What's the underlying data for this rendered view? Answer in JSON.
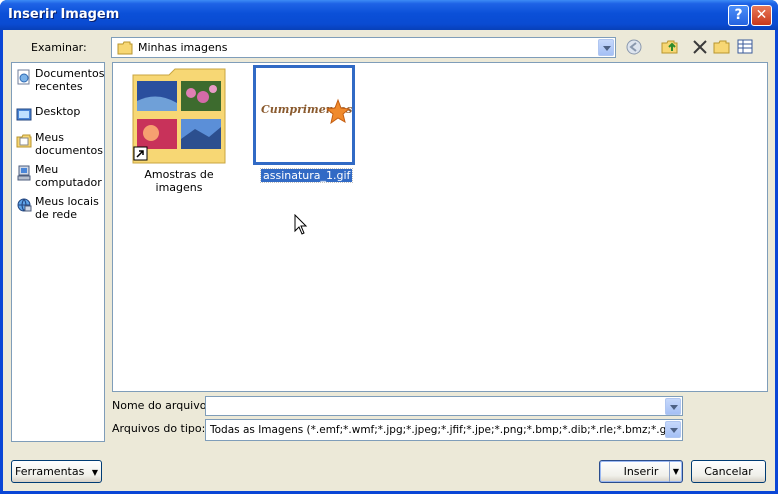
{
  "window": {
    "title": "Inserir Imagem"
  },
  "toolbar": {
    "look_in_label": "Examinar:",
    "look_in_value": "Minhas imagens"
  },
  "places": [
    {
      "label_line1": "Documentos",
      "label_line2": "recentes",
      "icon": "recent-documents-icon"
    },
    {
      "label_line1": "Desktop",
      "label_line2": "",
      "icon": "desktop-icon"
    },
    {
      "label_line1": "Meus",
      "label_line2": "documentos",
      "icon": "my-documents-icon"
    },
    {
      "label_line1": "Meu",
      "label_line2": "computador",
      "icon": "my-computer-icon"
    },
    {
      "label_line1": "Meus locais",
      "label_line2": "de rede",
      "icon": "network-places-icon"
    }
  ],
  "files": [
    {
      "name": "Amostras de imagens",
      "type": "folder-shortcut",
      "selected": false
    },
    {
      "name": "assinatura_1.gif",
      "type": "image",
      "selected": true,
      "preview_text": "Cumprimentos"
    }
  ],
  "form": {
    "filename_label": "Nome do arquivo:",
    "filename_value": "",
    "filetype_label": "Arquivos do tipo:",
    "filetype_value": "Todas as Imagens (*.emf;*.wmf;*.jpg;*.jpeg;*.jfif;*.jpe;*.png;*.bmp;*.dib;*.rle;*.bmz;*.gif"
  },
  "buttons": {
    "tools": "Ferramentas",
    "insert": "Inserir",
    "cancel": "Cancelar"
  },
  "colors": {
    "titlebar": "#0a4bd2",
    "dialog_bg": "#ece9d8",
    "selection": "#316ac5",
    "folder": "#f7d774"
  }
}
